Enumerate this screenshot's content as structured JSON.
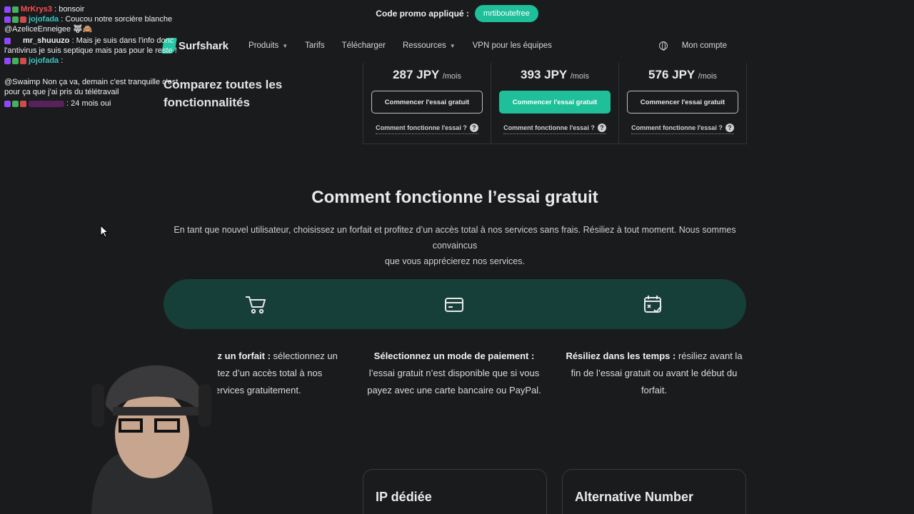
{
  "promo": {
    "label": "Code promo appliqué :",
    "code": "mrtiboutefree"
  },
  "nav": {
    "logo": "Surfshark",
    "items": [
      "Produits",
      "Tarifs",
      "Télécharger",
      "Ressources",
      "VPN pour les équipes"
    ],
    "account": "Mon compte"
  },
  "chat": [
    {
      "user": "MrKrys3",
      "color": "#ff4d4d",
      "text": " : bonsoir"
    },
    {
      "user": "jojofada",
      "color": "#3ec5c2",
      "text": " : Coucou notre sorcière blanche"
    },
    {
      "user": "",
      "color": "#f2f2f2",
      "text": "@AzeliceEnneigee 🐺🙈"
    },
    {
      "user": "mr_shuuuzo",
      "color": "#f2f2f2",
      "text": " : Mais je suis dans l'info donc"
    },
    {
      "user": "",
      "color": "#f2f2f2",
      "text": "l'antivirus je suis septique mais pas pour le reste !"
    },
    {
      "user": "jojofada",
      "color": "#3ec5c2",
      "text": " :"
    },
    {
      "user": "",
      "color": "#f2f2f2",
      "text": "@Swaimp Non ça va, demain c'est tranquille c'est"
    },
    {
      "user": "",
      "color": "#f2f2f2",
      "text": "pour ça que j'ai pris du télétravail"
    },
    {
      "user": "",
      "color": "#8a2a8a",
      "text": " : 24 mois oui"
    }
  ],
  "compare": {
    "line1": "Comparez toutes les",
    "line2": "fonctionnalités"
  },
  "plans": [
    {
      "price": "287 JPY",
      "per": "/mois",
      "button": "Commencer l'essai gratuit",
      "link": "Comment fonctionne l'essai ?",
      "primary": false
    },
    {
      "price": "393 JPY",
      "per": "/mois",
      "button": "Commencer l'essai gratuit",
      "link": "Comment fonctionne l'essai ?",
      "primary": true
    },
    {
      "price": "576 JPY",
      "per": "/mois",
      "button": "Commencer l'essai gratuit",
      "link": "Comment fonctionne l'essai ?",
      "primary": false
    }
  ],
  "section": {
    "title": "Comment fonctionne l’essai gratuit",
    "desc_line1": "En tant que nouvel utilisateur, choisissez un forfait et profitez d’un accès total à nos services sans frais. Résiliez à tout moment. Nous sommes convaincus",
    "desc_line2": "que vous apprécierez nos services."
  },
  "steps": [
    {
      "icon": "cart-icon",
      "title": "Choisissez un forfait :",
      "text1": " sélectionnez un",
      "text2": "et profitez d’un accès total à nos",
      "text3": "services gratuitement."
    },
    {
      "icon": "credit-card-icon",
      "title": "Sélectionnez un mode de paiement :",
      "text1": "",
      "text2": "l’essai gratuit n’est disponible que si vous",
      "text3": "payez avec une carte bancaire ou PayPal."
    },
    {
      "icon": "calendar-check-icon",
      "title": "Résiliez dans les temps :",
      "text1": " résiliez avant la",
      "text2": "fin de l’essai gratuit ou avant le début du",
      "text3": "forfait."
    }
  ],
  "features": [
    "IP dédiée",
    "Alternative Number"
  ],
  "colors": {
    "accent": "#1fbf9a",
    "steps_bar": "#173f3a",
    "background": "#1a1b1d"
  }
}
